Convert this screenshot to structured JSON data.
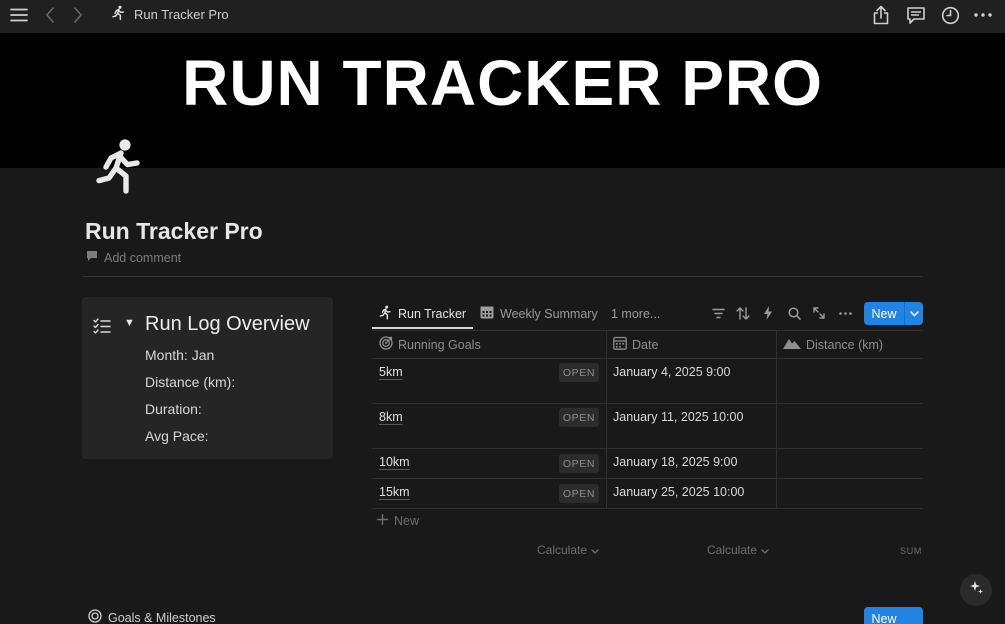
{
  "topbar": {
    "title": "Run Tracker Pro",
    "icons": [
      "menu-icon",
      "back-icon",
      "forward-icon",
      "runner-icon",
      "share-icon",
      "comments-icon",
      "history-icon",
      "more-icon"
    ]
  },
  "banner": {
    "title": "RUN TRACKER PRO"
  },
  "page": {
    "title": "Run Tracker Pro",
    "add_comment": "Add comment"
  },
  "card": {
    "title": "Run Log Overview",
    "lines": [
      "Month: Jan",
      "Distance (km):",
      "Duration:",
      "Avg Pace:"
    ]
  },
  "database": {
    "views": [
      {
        "label": "Run Tracker",
        "active": true
      },
      {
        "label": "Weekly Summary",
        "active": false
      }
    ],
    "more_views": "1 more...",
    "new_label": "New",
    "columns": [
      "Running Goals",
      "Date",
      "Distance (km)"
    ],
    "rows": [
      {
        "name": "5km",
        "status": "OPEN",
        "date": "January 4, 2025 9:00"
      },
      {
        "name": "8km",
        "status": "OPEN",
        "date": "January 11, 2025 10:00"
      },
      {
        "name": "10km",
        "status": "OPEN",
        "date": "January 18, 2025 9:00"
      },
      {
        "name": "15km",
        "status": "OPEN",
        "date": "January 25, 2025 10:00"
      }
    ],
    "add_row": "New",
    "calculate": "Calculate",
    "sum": "SUM"
  },
  "second_section": {
    "label": "Goals & Milestones",
    "new_label": "New"
  },
  "colors": {
    "accent": "#2383e2",
    "background": "#191919",
    "banner": "#000000"
  }
}
